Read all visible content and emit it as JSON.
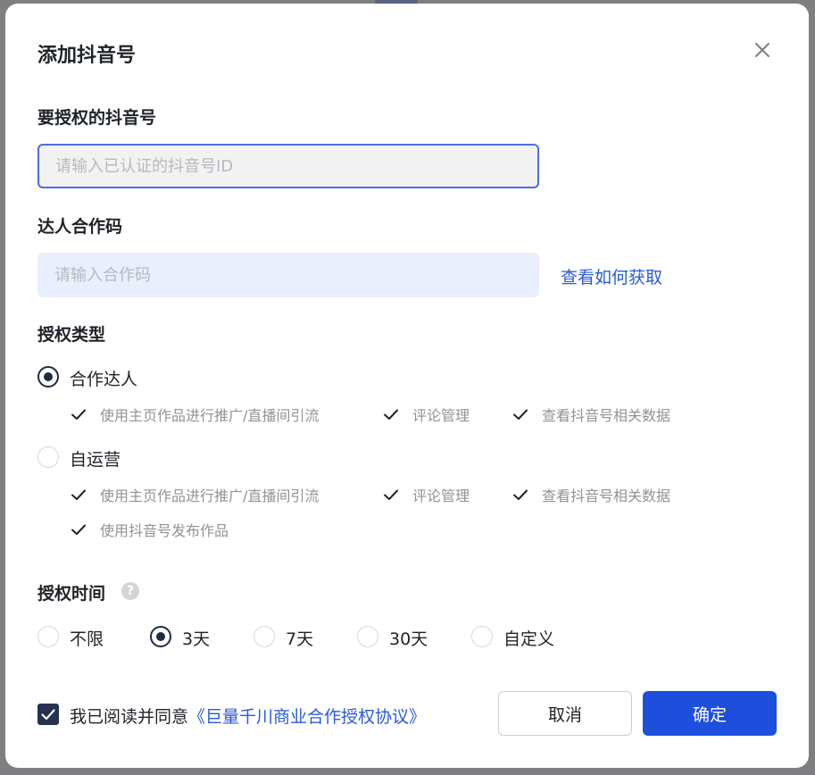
{
  "dialog": {
    "title": "添加抖音号",
    "close_icon": "close-icon"
  },
  "douyin_id": {
    "label": "要授权的抖音号",
    "placeholder": "请输入已认证的抖音号ID",
    "value": ""
  },
  "cooperation_code": {
    "label": "达人合作码",
    "placeholder": "请输入合作码",
    "value": "",
    "help_link": "查看如何获取"
  },
  "auth_type": {
    "label": "授权类型",
    "options": [
      {
        "label": "合作达人",
        "selected": true,
        "permissions": [
          "使用主页作品进行推广/直播间引流",
          "评论管理",
          "查看抖音号相关数据"
        ]
      },
      {
        "label": "自运营",
        "selected": false,
        "permissions": [
          "使用主页作品进行推广/直播间引流",
          "评论管理",
          "查看抖音号相关数据",
          "使用抖音号发布作品"
        ]
      }
    ]
  },
  "auth_time": {
    "label": "授权时间",
    "help_icon": "question-icon",
    "help_glyph": "?",
    "options": [
      {
        "label": "不限",
        "selected": false
      },
      {
        "label": "3天",
        "selected": true
      },
      {
        "label": "7天",
        "selected": false
      },
      {
        "label": "30天",
        "selected": false
      },
      {
        "label": "自定义",
        "selected": false
      }
    ]
  },
  "footer": {
    "agree_checked": true,
    "agree_text": "我已阅读并同意",
    "agreement_link": "《巨量千川商业合作授权协议》",
    "cancel_label": "取消",
    "confirm_label": "确定"
  },
  "colors": {
    "primary": "#1d4fdc",
    "link": "#2a5ad8",
    "radio_checked": "#1f2a44"
  }
}
